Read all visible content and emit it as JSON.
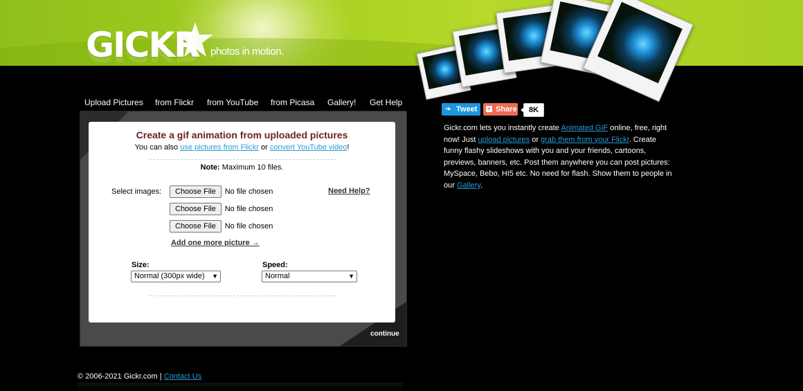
{
  "header": {
    "logo_text": "GICKR",
    "tagline": "photos in motion."
  },
  "nav": {
    "items": [
      "Upload Pictures",
      "from Flickr",
      "from YouTube",
      "from Picasa",
      "Gallery!",
      "Get Help"
    ]
  },
  "form": {
    "title": "Create a gif animation from uploaded pictures",
    "subtitle_prefix": "You can also ",
    "subtitle_link1": "use pictures from Flickr",
    "subtitle_or": " or ",
    "subtitle_link2": "convert YouTube video",
    "subtitle_suffix": "!",
    "note_label": "Note:",
    "note_text": " Maximum 10 files.",
    "select_images_label": "Select images:",
    "file_inputs": [
      {
        "button": "Choose File",
        "status": "No file chosen"
      },
      {
        "button": "Choose File",
        "status": "No file chosen"
      },
      {
        "button": "Choose File",
        "status": "No file chosen"
      }
    ],
    "need_help": "Need Help?",
    "add_more": "Add one more picture →",
    "size_label": "Size:",
    "size_value": "Normal (300px wide)",
    "speed_label": "Speed:",
    "speed_value": "Normal",
    "continue": "continue"
  },
  "social": {
    "tweet": "Tweet",
    "share": "Share",
    "count": "8K"
  },
  "description": {
    "t1": "Gickr.com lets you instantly create ",
    "l1": "Animated GIF",
    "t2": " online, free, right now! Just ",
    "l2": "upload pictures",
    "t3": " or ",
    "l3": "grab them from your Flickr",
    "t4": ". Create funny flashy slideshows with you and your friends, cartoons, previews, banners, etc. Post them anywhere you can post pictures: MySpace, Bebo, HI5 etc. No need for flash. Show them to people in our ",
    "l4": "Gallery",
    "t5": "."
  },
  "footer": {
    "copyright": "© 2006-2021 Gickr.com | ",
    "contact": "Contact Us"
  },
  "colors": {
    "header_green": "#a6cf22",
    "link_blue": "#2a9ad8",
    "title_red": "#6b1f1f",
    "tweet_blue": "#1d95e0",
    "share_red": "#f06b55"
  }
}
